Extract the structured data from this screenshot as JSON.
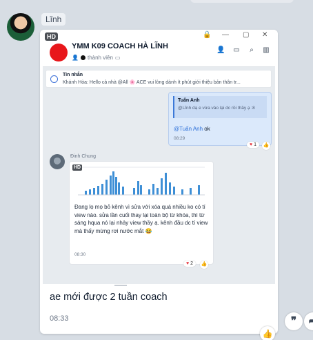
{
  "sender_name": "Lĩnh",
  "embedded": {
    "hd_badge": "HD",
    "group": {
      "title": "YMM K09 COACH HÀ LĨNH",
      "members": "thành viên"
    },
    "pinned": {
      "title": "Tin nhắn",
      "text": "Khánh Hòa: Hello cả nhà @All 🌸 ACE vui lòng dành ít phút giới thiệu bản thân tr..."
    },
    "my_message": {
      "quote_name": "Tuấn Anh",
      "quote_text": "@Lĩnh dạ e vừa vào lại dc rồi thầy ạ :8",
      "mention": "@Tuấn Anh",
      "text": " ok",
      "time": "08:29",
      "reaction_count": "1"
    },
    "other_message": {
      "name": "Đinh Chung",
      "hd_badge": "HD",
      "text": "Đang lọ mọ bỏ kênh vì sửa với xóa quá nhiều ko có tí view nào. sửa lần cuối thay lại toàn bộ từ khóa, thì từ sáng  hqua nó lại nhảy view thầy ạ. kênh đầu dc tí view mà thấy mừng rơi nước mắt 😂",
      "time": "08:30",
      "reaction_count": "2"
    }
  },
  "message": {
    "text": "ae mới được 2 tuần coach",
    "time": "08:33"
  },
  "icons": [
    "like-icon",
    "quote-icon",
    "share-icon",
    "heart-icon",
    "lock-icon",
    "minimize-icon",
    "maximize-icon",
    "close-icon",
    "add-member-icon",
    "video-call-icon",
    "search-icon",
    "sidebar-icon"
  ],
  "colors": {
    "background": "#d7dde4",
    "accent": "#3b78d8",
    "mine_bubble": "#dbe9fb",
    "group_avatar": "#e8171b"
  }
}
